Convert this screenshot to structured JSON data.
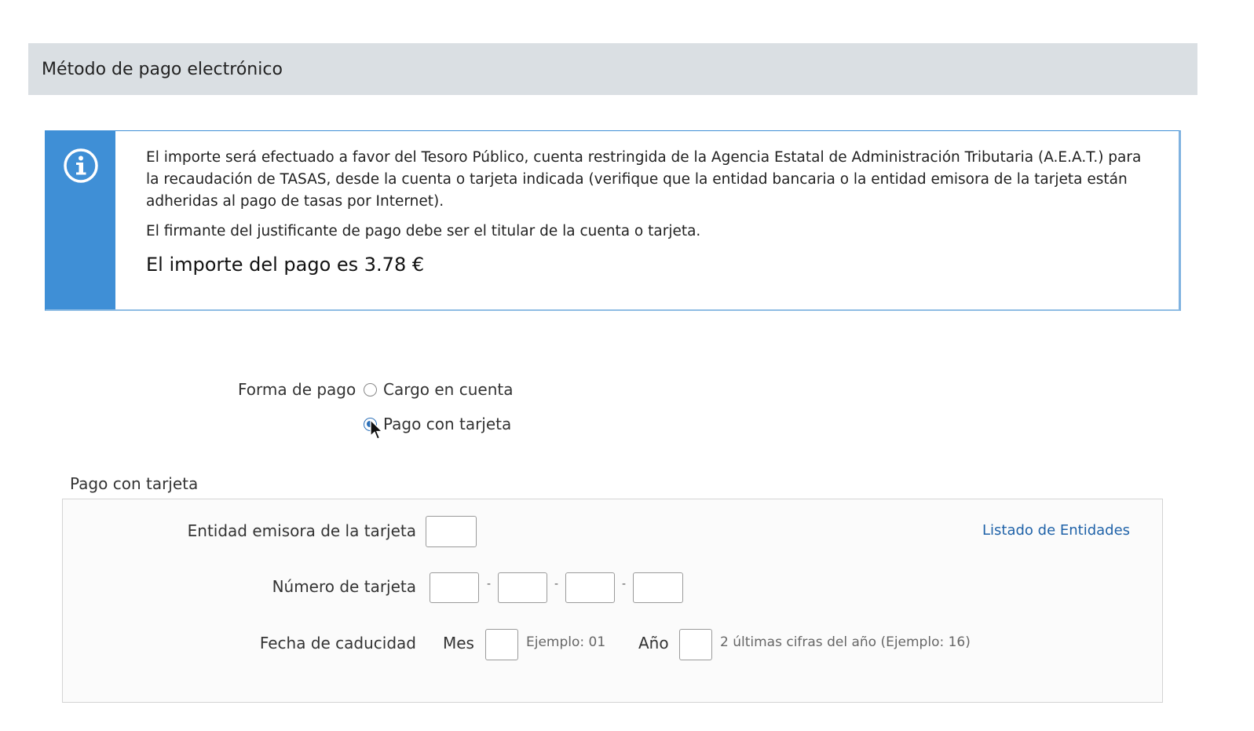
{
  "section": {
    "title": "Método de pago electrónico"
  },
  "info": {
    "icon": "info-icon",
    "paragraph1": "El importe será efectuado a favor del Tesoro Público, cuenta restringida de la Agencia Estatal de Administración Tributaria (A.E.A.T.) para la recaudación de TASAS, desde la cuenta o tarjeta indicada (verifique que la entidad bancaria o la entidad emisora de la tarjeta están adheridas al pago de tasas por Internet).",
    "paragraph2": "El firmante del justificante de pago debe ser el titular de la cuenta o tarjeta.",
    "amount": "El importe del pago es 3.78 €"
  },
  "payment": {
    "label": "Forma de pago",
    "options": [
      {
        "label": "Cargo en cuenta",
        "checked": false
      },
      {
        "label": "Pago con tarjeta",
        "checked": true
      }
    ]
  },
  "card": {
    "legend": "Pago con tarjeta",
    "issuer_label": "Entidad emisora de la tarjeta",
    "issuer_value": "",
    "entities_link": "Listado de Entidades",
    "number_label": "Número de tarjeta",
    "number_parts": [
      "",
      "",
      "",
      ""
    ],
    "separator": "-",
    "expiry_label": "Fecha de caducidad",
    "month_label": "Mes",
    "month_value": "",
    "month_hint": "Ejemplo: 01",
    "year_label": "Año",
    "year_value": "",
    "year_hint": "2 últimas cifras del año (Ejemplo: 16)"
  },
  "colors": {
    "accent": "#3f8fd6",
    "header_bg": "#dadfe3",
    "link": "#1f62a8"
  }
}
